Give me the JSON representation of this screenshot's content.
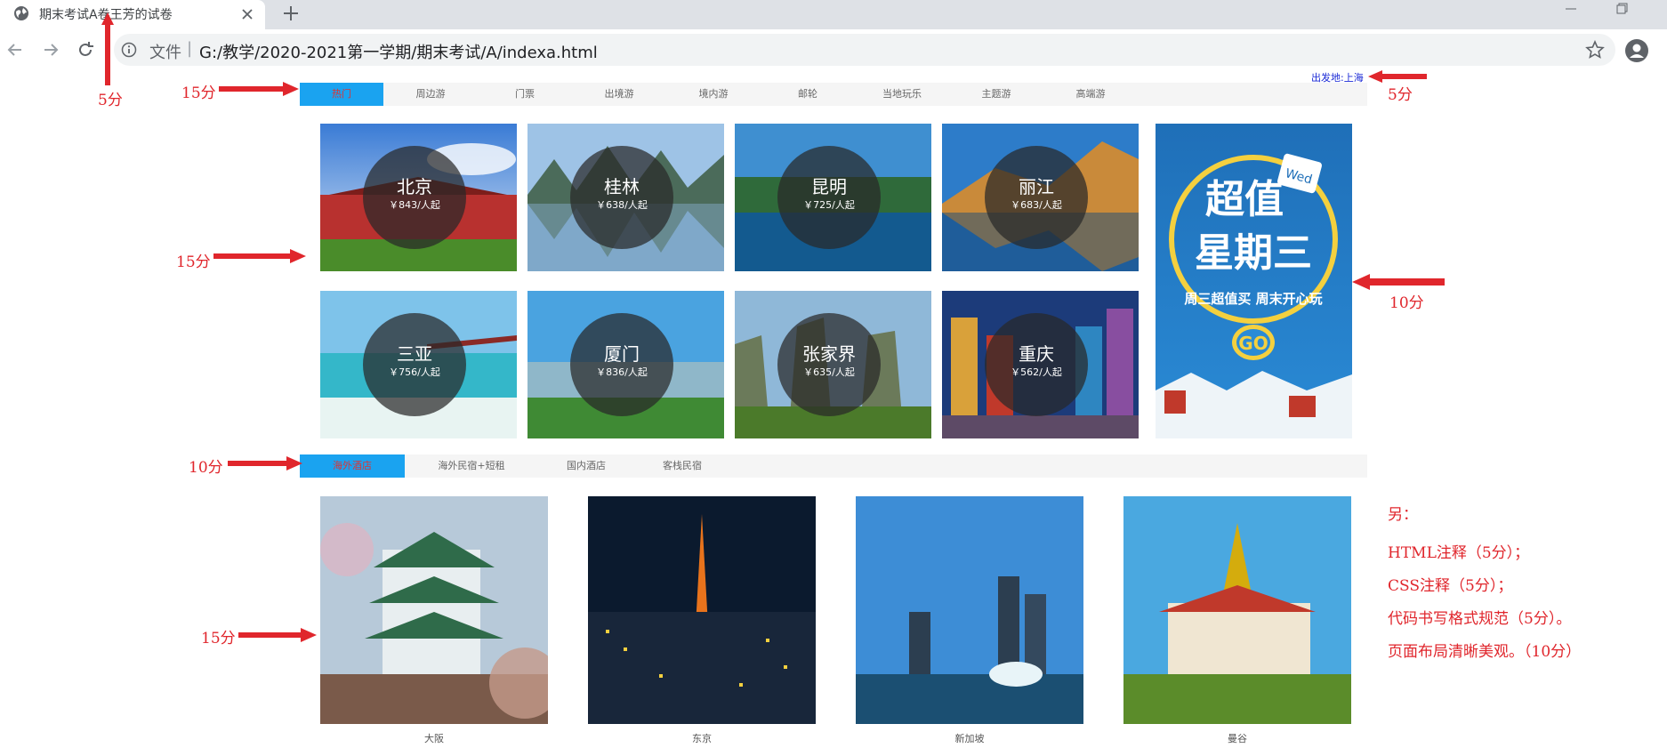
{
  "browser": {
    "tab_title": "期末考试A卷王芳的试卷",
    "address_scheme_label": "文件",
    "address_separator": "|",
    "address_url": "G:/教学/2020-2021第一学期/期末考试/A/indexa.html"
  },
  "departure": {
    "label": "出发地:上海"
  },
  "nav": {
    "items": [
      "热门",
      "周边游",
      "门票",
      "出境游",
      "境内游",
      "邮轮",
      "当地玩乐",
      "主题游",
      "高端游"
    ],
    "active_index": 0
  },
  "destinations": [
    {
      "city": "北京",
      "price": "￥843/人起"
    },
    {
      "city": "桂林",
      "price": "￥638/人起"
    },
    {
      "city": "昆明",
      "price": "￥725/人起"
    },
    {
      "city": "丽江",
      "price": "￥683/人起"
    },
    {
      "city": "三亚",
      "price": "￥756/人起"
    },
    {
      "city": "厦门",
      "price": "￥836/人起"
    },
    {
      "city": "张家界",
      "price": "￥635/人起"
    },
    {
      "city": "重庆",
      "price": "￥562/人起"
    }
  ],
  "promo": {
    "line1": "超值",
    "line2": "星期三",
    "badge": "Wed",
    "slogan": "周三超值买 周末开心玩",
    "button": "GO"
  },
  "hotel_tabs": {
    "items": [
      "海外酒店",
      "海外民宿+短租",
      "国内酒店",
      "客栈民宿"
    ],
    "active_index": 0
  },
  "hotels": [
    {
      "name": "大阪"
    },
    {
      "name": "东京"
    },
    {
      "name": "新加坡"
    },
    {
      "name": "曼谷"
    }
  ],
  "annotations": {
    "tab_score": "5分",
    "nav_score": "15分",
    "departure_score": "5分",
    "grid_score": "15分",
    "promo_score": "10分",
    "hotel_tab_score": "10分",
    "hotel_score": "15分",
    "notes_title": "另：",
    "notes": [
      "HTML注释（5分）；",
      "CSS注释（5分）；",
      "代码书写格式规范（5分）。",
      "页面布局清晰美观。（10分）"
    ]
  },
  "colors": {
    "accent": "#1aa3f0",
    "annotation_red": "#e0262c",
    "active_text": "#d33333",
    "departure_link": "#1a29d6"
  }
}
